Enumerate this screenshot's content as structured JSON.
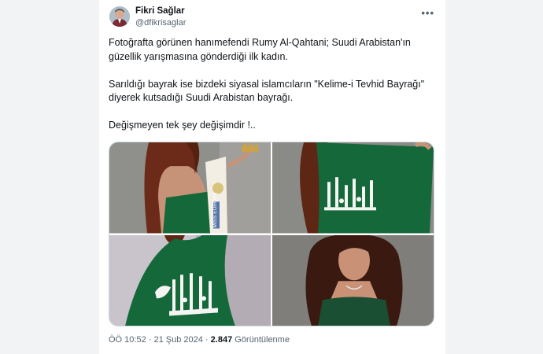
{
  "author": {
    "name": "Fikri Sağlar",
    "handle": "@dfikrisaglar"
  },
  "more_icon": "more-horizontal-icon",
  "tweet": {
    "paragraphs": [
      "Fotoğrafta görünen hanımefendi Rumy Al-Qahtani; Suudi Arabistan'ın güzellik yarışmasına gönderdiği ilk kadın.",
      "Sarıldığı bayrak ise bizdeki siyasal islamcıların \"Kelime-i Tevhid Bayrağı\" diyerek kutsadığı Suudi Arabistan bayrağı.",
      "Değişmeyen tek şey değişimdir !.."
    ]
  },
  "sash_text": "MISS EUROPE",
  "footer": {
    "time": "ÖÖ 10:52",
    "sep1": " · ",
    "date": "21 Şub 2024",
    "sep2": " · ",
    "views": "2.847",
    "views_label": "Görüntülenme"
  },
  "colors": {
    "flag_green": "#14683a",
    "background": "#f2f3f5",
    "text_primary": "#0f1419",
    "text_secondary": "#536471"
  }
}
